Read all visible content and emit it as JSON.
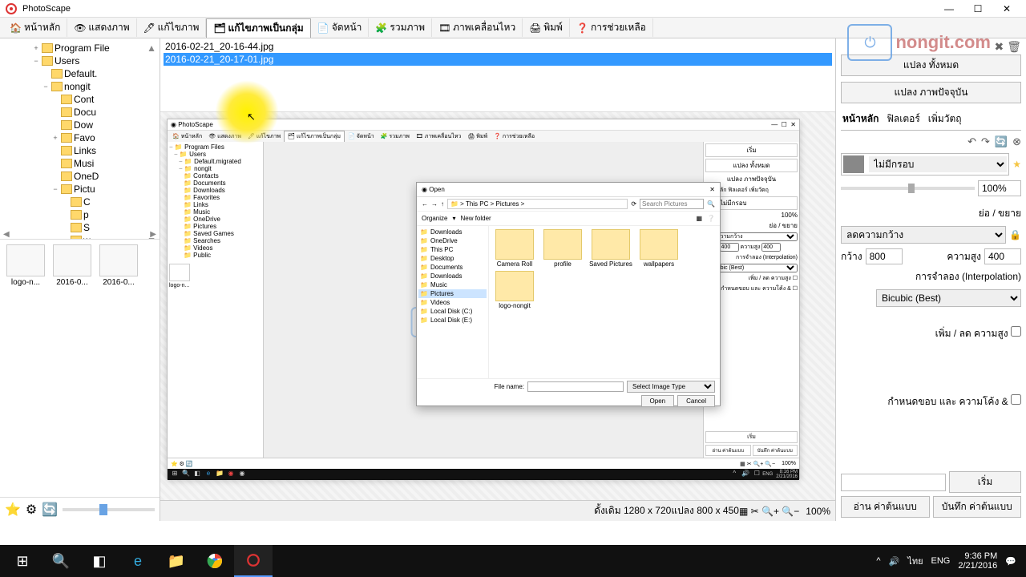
{
  "app": {
    "title": "PhotoScape"
  },
  "win": {
    "min": "—",
    "max": "☐",
    "close": "✕"
  },
  "tabs": [
    {
      "label": "หน้าหลัก",
      "icon": "home"
    },
    {
      "label": "แสดงภาพ",
      "icon": "view"
    },
    {
      "label": "แก้ไขภาพ",
      "icon": "edit"
    },
    {
      "label": "แก้ไขภาพเป็นกลุ่ม",
      "icon": "batch",
      "active": true
    },
    {
      "label": "จัดหน้า",
      "icon": "page"
    },
    {
      "label": "รวมภาพ",
      "icon": "combine"
    },
    {
      "label": "ภาพเคลื่อนไหว",
      "icon": "anim"
    },
    {
      "label": "พิมพ์",
      "icon": "print"
    },
    {
      "label": "การช่วยเหลือ",
      "icon": "help"
    }
  ],
  "tree": [
    {
      "indent": 3,
      "exp": "+",
      "label": "Program File",
      "trunc": true,
      "scroll_up": true
    },
    {
      "indent": 3,
      "exp": "−",
      "label": "Users"
    },
    {
      "indent": 4,
      "exp": "",
      "label": "Default.",
      "trunc": true
    },
    {
      "indent": 4,
      "exp": "−",
      "label": "nongit"
    },
    {
      "indent": 5,
      "exp": "",
      "label": "Cont",
      "trunc": true,
      "icon": "doc"
    },
    {
      "indent": 5,
      "exp": "",
      "label": "Docu",
      "trunc": true,
      "icon": "doc"
    },
    {
      "indent": 5,
      "exp": "",
      "label": "Dow",
      "trunc": true,
      "icon": "down"
    },
    {
      "indent": 5,
      "exp": "+",
      "label": "Favo",
      "trunc": true,
      "icon": "star"
    },
    {
      "indent": 5,
      "exp": "",
      "label": "Links",
      "icon": "link"
    },
    {
      "indent": 5,
      "exp": "",
      "label": "Musi",
      "trunc": true,
      "icon": "music"
    },
    {
      "indent": 5,
      "exp": "",
      "label": "OneD",
      "trunc": true,
      "icon": "cloud"
    },
    {
      "indent": 5,
      "exp": "−",
      "label": "Pictu",
      "trunc": true,
      "icon": "pic"
    },
    {
      "indent": 6,
      "exp": "",
      "label": "C",
      "trunc": true
    },
    {
      "indent": 6,
      "exp": "",
      "label": "p",
      "trunc": true
    },
    {
      "indent": 6,
      "exp": "",
      "label": "S",
      "trunc": true
    },
    {
      "indent": 6,
      "exp": "",
      "label": "w",
      "trunc": true,
      "scroll_down": true
    }
  ],
  "thumbs": [
    {
      "label": "logo-n..."
    },
    {
      "label": "2016-0..."
    },
    {
      "label": "2016-0..."
    }
  ],
  "files": [
    {
      "name": "2016-02-21_20-16-44.jpg"
    },
    {
      "name": "2016-02-21_20-17-01.jpg",
      "selected": true
    }
  ],
  "right": {
    "convert_all": "แปลง ทั้งหมด",
    "convert_current": "แปลง ภาพปัจจุบัน",
    "tabs": [
      "หน้าหลัก",
      "ฟิลเตอร์",
      "เพิ่มวัตถุ"
    ],
    "frame_select": "ไม่มีกรอบ",
    "zoom_label": "100%",
    "resize_header": "ย่อ / ขยาย",
    "resize_select": "ลดความกว้าง",
    "width_label": "กว้าง",
    "width_val": "800",
    "height_label": "ความสูง",
    "height_val": "400",
    "interp_header": "การจำลอง (Interpolation)",
    "interp_select": "Bicubic (Best)",
    "addsub_label": "เพิ่ม / ลด ความสูง",
    "border_label": "กำหนดขอบ และ ความโค้ง &",
    "load_label": "อ่าน ค่าต้นแบบ",
    "save_label": "บันทึก ค่าต้นแบบ",
    "start_label": "เริ่ม"
  },
  "status": {
    "original": "ดั้งเดิม 1280 x 720",
    "convert": "แปลง 800 x 450",
    "zoom": "100%"
  },
  "inner": {
    "title": "PhotoScape",
    "tree": [
      "Program Files",
      "Users",
      "Default.migrated",
      "nongit",
      "Contacts",
      "Documents",
      "Downloads",
      "Favorites",
      "Links",
      "Music",
      "OneDrive",
      "Pictures",
      "Saved Games",
      "Searches",
      "Videos",
      "Public"
    ],
    "thumb": "logo-n...",
    "right": {
      "start": "เริ่ม",
      "convert_all": "แปลง ทั้งหมด",
      "convert_current": "แปลง ภาพปัจจุบัน",
      "tabs": "หน้าหลัก  ฟิลเตอร์  เพิ่มวัตถุ",
      "frame": "ไม่มีกรอบ",
      "zoom": "100%",
      "resize_hdr": "ย่อ / ขยาย",
      "resize_sel": "ลดความกว้าง",
      "w": "400",
      "h": "400",
      "interp_hdr": "การจำลอง (Interpolation)",
      "interp": "Bicubic (Best)",
      "addsub": "เพิ่ม / ลด ความสูง",
      "border": "กำหนดขอบ และ ความโค้ง &",
      "load": "อ่าน ค่าต้นแบบ",
      "save": "บันทึก ค่าต้นแบบ"
    },
    "status_zoom": "100%",
    "tray_lang": "ENG",
    "tray_time": "8:16 PM",
    "tray_date": "2/21/2016"
  },
  "dialog": {
    "title": "Open",
    "crumbs": [
      "This PC",
      "Pictures"
    ],
    "search_ph": "Search Pictures",
    "organize": "Organize",
    "newfolder": "New folder",
    "side": [
      "Downloads",
      "OneDrive",
      "This PC",
      "Desktop",
      "Documents",
      "Downloads",
      "Music",
      "Pictures",
      "Videos",
      "Local Disk (C:)",
      "Local Disk (E:)"
    ],
    "side_sel": "Pictures",
    "items": [
      "Camera Roll",
      "profile",
      "Saved Pictures",
      "wallpapers",
      "logo-nongit"
    ],
    "fname_label": "File name:",
    "type_label": "Select Image Type",
    "open": "Open",
    "cancel": "Cancel"
  },
  "watermark": "nongit.com",
  "taskbar": {
    "lang_short": "ไทย",
    "lang": "ENG",
    "time": "9:36 PM",
    "date": "2/21/2016"
  }
}
